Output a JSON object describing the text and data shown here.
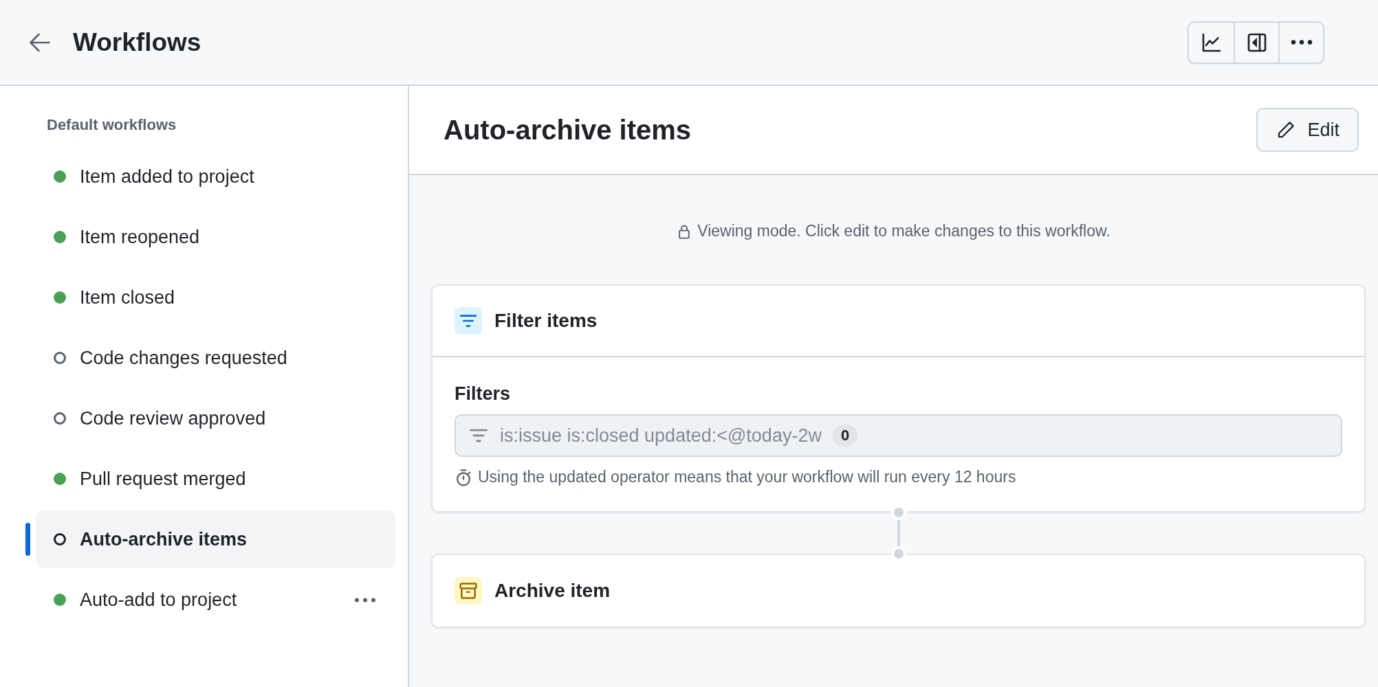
{
  "header": {
    "title": "Workflows"
  },
  "sidebar": {
    "section_title": "Default workflows",
    "items": [
      {
        "label": "Item added to project",
        "enabled": true,
        "selected": false,
        "more_button": false
      },
      {
        "label": "Item reopened",
        "enabled": true,
        "selected": false,
        "more_button": false
      },
      {
        "label": "Item closed",
        "enabled": true,
        "selected": false,
        "more_button": false
      },
      {
        "label": "Code changes requested",
        "enabled": false,
        "selected": false,
        "more_button": false
      },
      {
        "label": "Code review approved",
        "enabled": false,
        "selected": false,
        "more_button": false
      },
      {
        "label": "Pull request merged",
        "enabled": true,
        "selected": false,
        "more_button": false
      },
      {
        "label": "Auto-archive items",
        "enabled": false,
        "selected": true,
        "more_button": false
      },
      {
        "label": "Auto-add to project",
        "enabled": true,
        "selected": false,
        "more_button": true
      }
    ]
  },
  "main": {
    "title": "Auto-archive items",
    "edit_button": "Edit",
    "viewing_notice": "Viewing mode. Click edit to make changes to this workflow.",
    "steps": [
      {
        "kind": "filter",
        "title": "Filter items",
        "field_label": "Filters",
        "filter_value": "is:issue is:closed updated:<@today-2w",
        "count": "0",
        "note": "Using the updated operator means that your workflow will run every 12 hours"
      },
      {
        "kind": "archive",
        "title": "Archive item"
      }
    ]
  }
}
